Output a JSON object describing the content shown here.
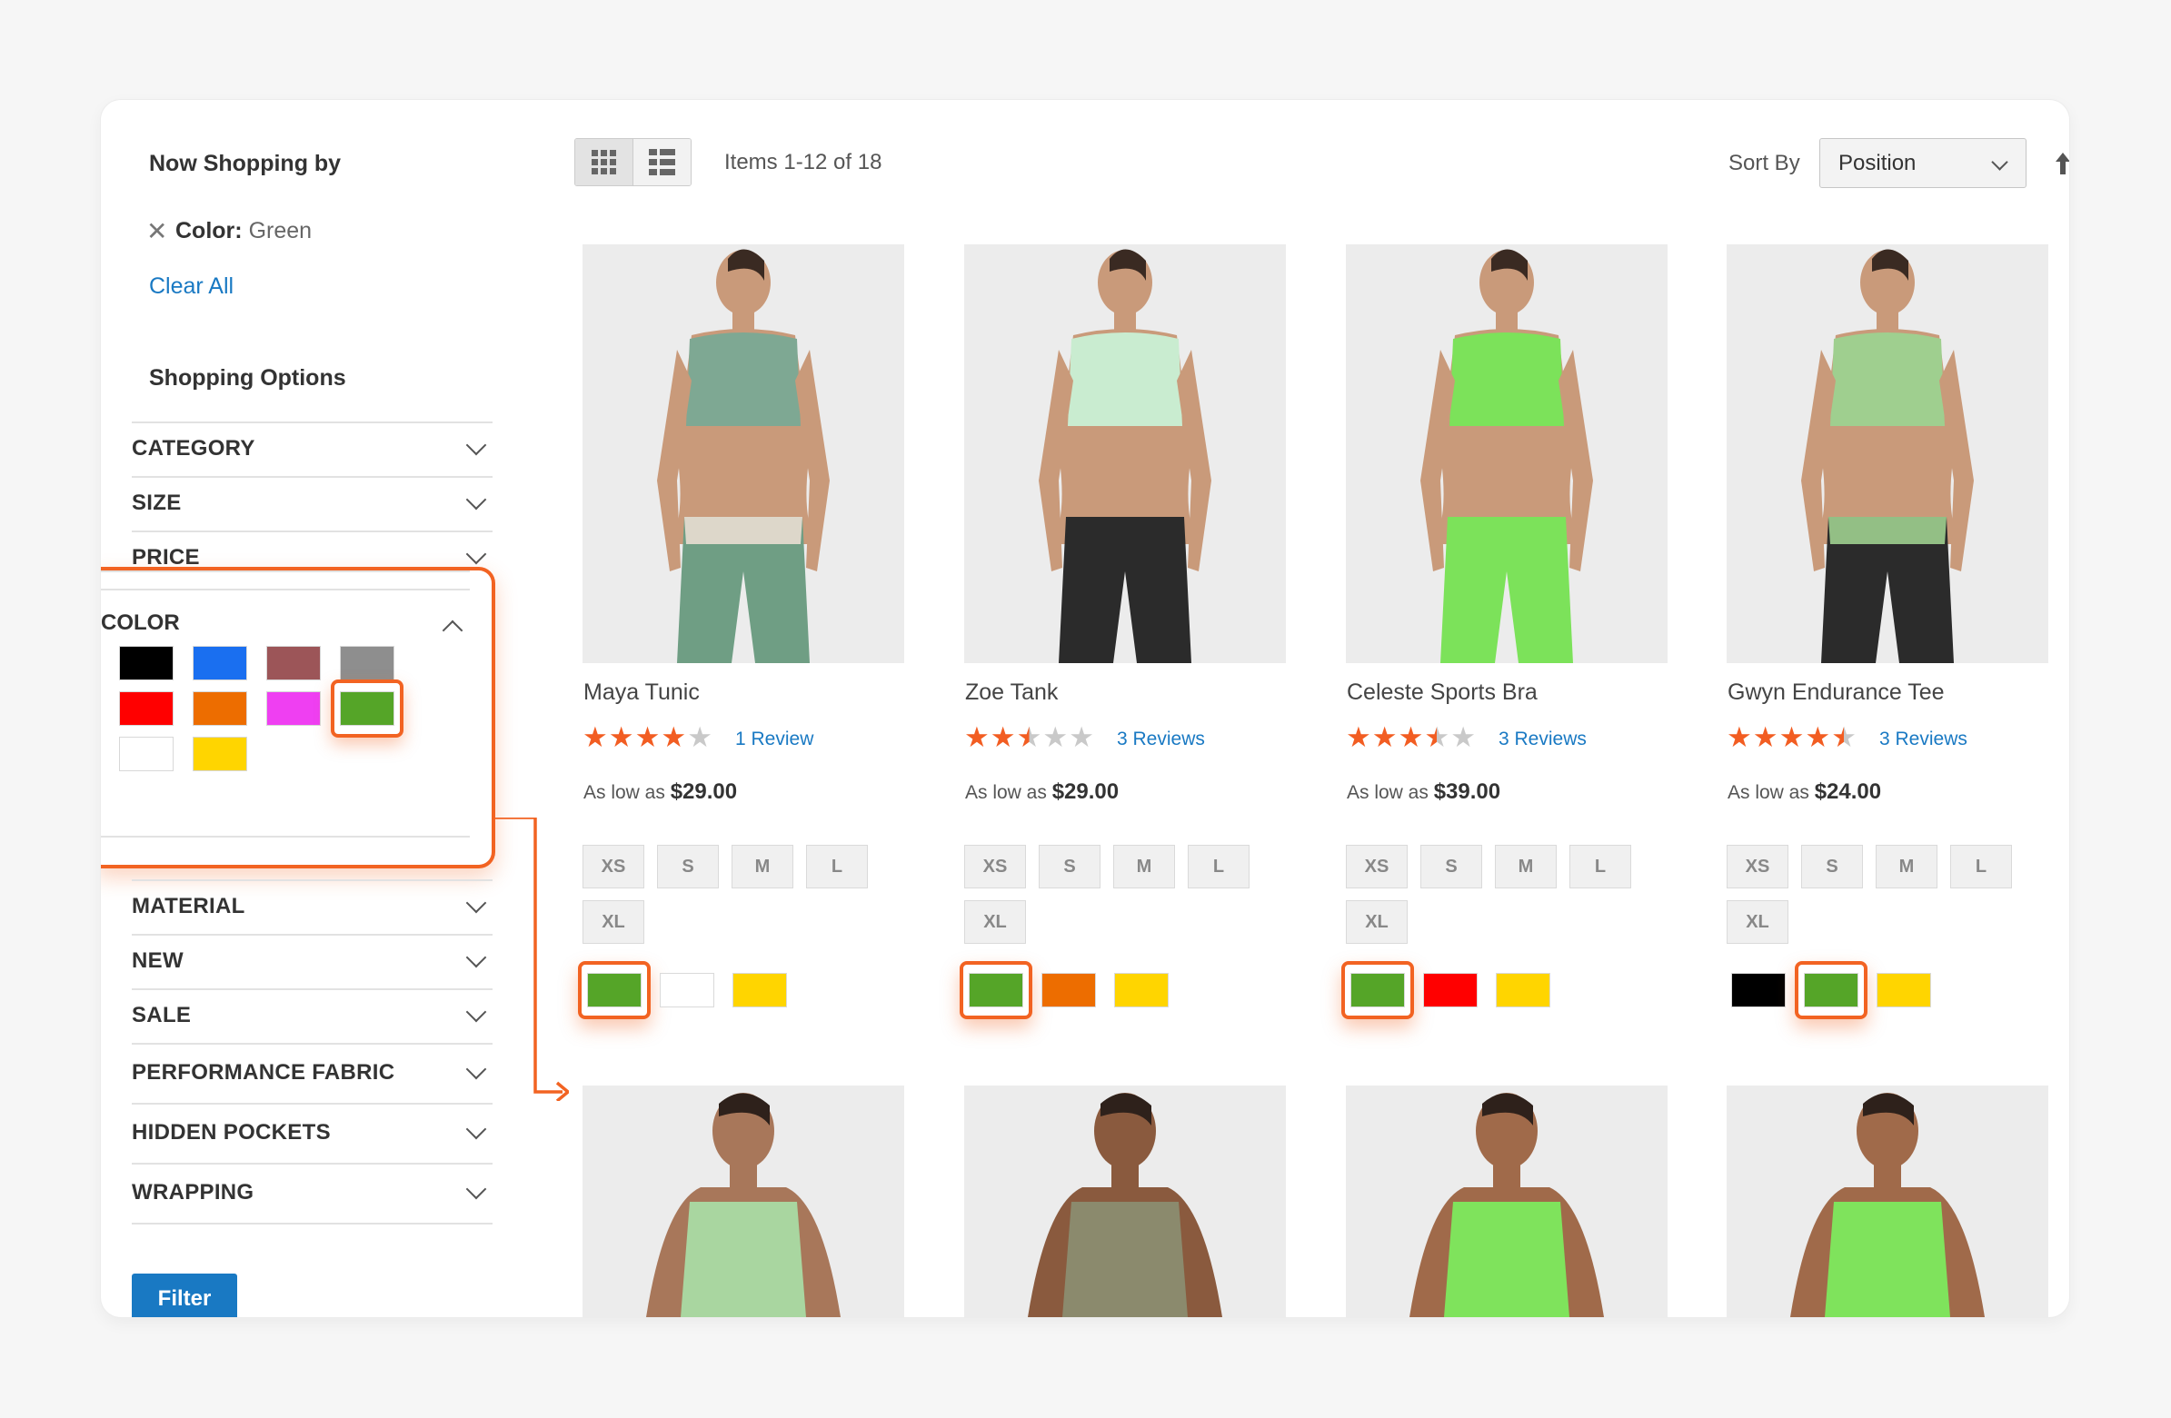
{
  "sidebar": {
    "now_shopping_title": "Now Shopping by",
    "active_filter": {
      "label": "Color:",
      "value": "Green"
    },
    "clear_all": "Clear All",
    "shopping_options_title": "Shopping Options",
    "facets_top": [
      "CATEGORY",
      "SIZE",
      "PRICE"
    ],
    "color_facet": {
      "title": "COLOR",
      "swatches": [
        "#000000",
        "#1a6ff0",
        "#9c5558",
        "#8e8e8e",
        "#ff0000",
        "#ed6d00",
        "#ef3ff2",
        "#55a528",
        "#ffffff",
        "#ffd500"
      ],
      "selected_color": "#55a528"
    },
    "facets_bottom": [
      "MATERIAL",
      "NEW",
      "SALE",
      "PERFORMANCE FABRIC",
      "HIDDEN POCKETS",
      "WRAPPING"
    ],
    "filter_button": "Filter"
  },
  "toolbar": {
    "items_count": "Items 1-12 of 18",
    "sort_label": "Sort By",
    "sort_value": "Position"
  },
  "products": [
    {
      "name": "Maya Tunic",
      "rating": 4,
      "reviews": "1 Review",
      "price_prefix": "As low as",
      "price": "$29.00",
      "sizes": [
        "XS",
        "S",
        "M",
        "L",
        "XL"
      ],
      "colors": [
        "#55a528",
        "#ffffff",
        "#ffd500"
      ],
      "selected_color": "#55a528",
      "outfit": {
        "top": "#7ea893",
        "bottom": "#6f9e84",
        "accent": "#e9ddd1"
      }
    },
    {
      "name": "Zoe Tank",
      "rating": 2.5,
      "reviews": "3 Reviews",
      "price_prefix": "As low as",
      "price": "$29.00",
      "sizes": [
        "XS",
        "S",
        "M",
        "L",
        "XL"
      ],
      "colors": [
        "#55a528",
        "#ed6d00",
        "#ffd500"
      ],
      "selected_color": "#55a528",
      "outfit": {
        "top": "#c9ecd0",
        "bottom": "#2b2b2b",
        "accent": "#2b2b2b"
      }
    },
    {
      "name": "Celeste Sports Bra",
      "rating": 3.5,
      "reviews": "3 Reviews",
      "price_prefix": "As low as",
      "price": "$39.00",
      "sizes": [
        "XS",
        "S",
        "M",
        "L",
        "XL"
      ],
      "colors": [
        "#55a528",
        "#ff0000",
        "#ffd500"
      ],
      "selected_color": "#55a528",
      "outfit": {
        "top": "#7ce25a",
        "bottom": "#7ce25a",
        "accent": "#7ce25a"
      }
    },
    {
      "name": "Gwyn Endurance Tee",
      "rating": 4.5,
      "reviews": "3 Reviews",
      "price_prefix": "As low as",
      "price": "$24.00",
      "sizes": [
        "XS",
        "S",
        "M",
        "L",
        "XL"
      ],
      "colors": [
        "#000000",
        "#55a528",
        "#ffd500"
      ],
      "selected_color": "#55a528",
      "outfit": {
        "top": "#9fcf8f",
        "bottom": "#2b2b2b",
        "accent": "#9fcf8f"
      }
    }
  ],
  "products_row2": [
    {
      "outfit": "#a9d6a0",
      "skin": "#a8775a"
    },
    {
      "outfit": "#8b8a6d",
      "skin": "#8a5a3e"
    },
    {
      "outfit": "#7fe35c",
      "skin": "#a06a4a"
    },
    {
      "outfit": "#7fe35c",
      "skin": "#a06a4a"
    }
  ],
  "colors": {
    "accent": "#f26322",
    "link": "#1979c3",
    "star": "#f25d22"
  }
}
